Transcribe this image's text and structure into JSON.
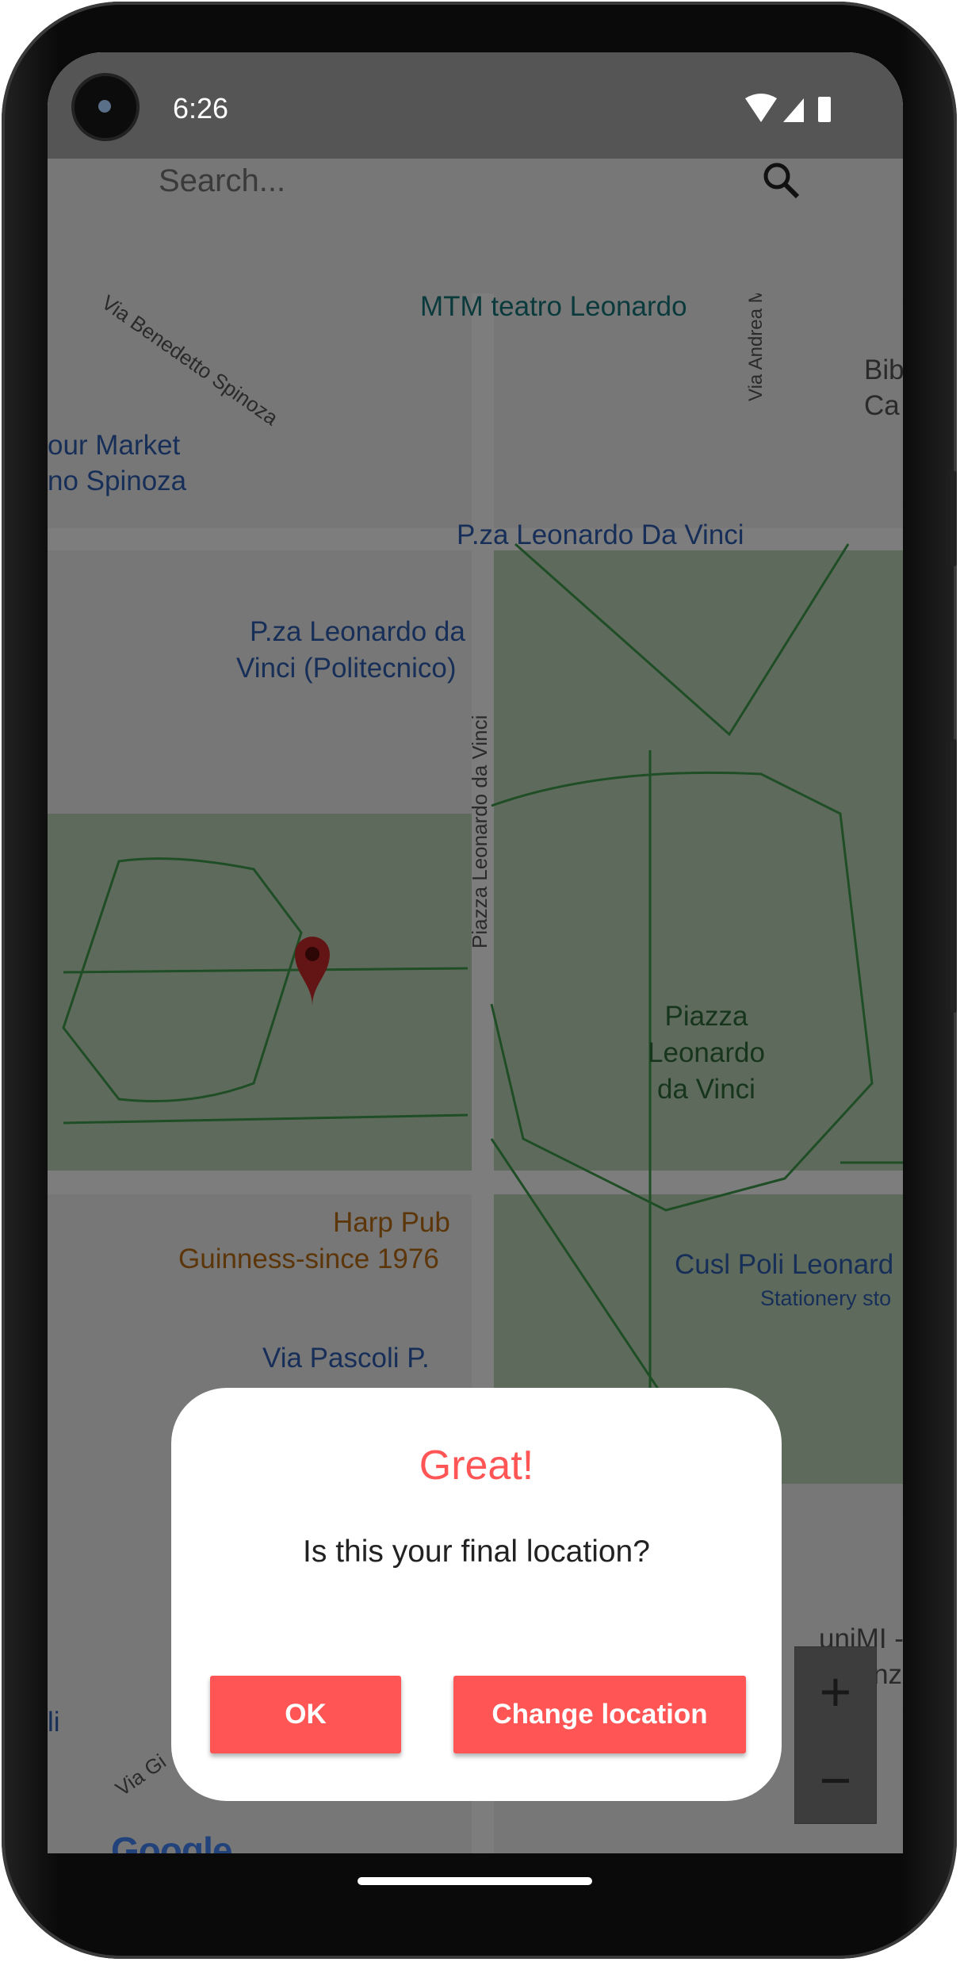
{
  "status_bar": {
    "time": "6:26",
    "icons": [
      "wifi-icon",
      "cellular-signal-icon",
      "battery-icon"
    ]
  },
  "search": {
    "placeholder": "Search...",
    "icon": "search-icon"
  },
  "map": {
    "labels": {
      "street_spinoza": "Via Benedetto Spinoza",
      "mtm": "MTM teatro Leonardo",
      "street_andrea": "Via Andrea Mar",
      "bib_1": "Bib",
      "bib_2": "Ca",
      "market_1": "our Market",
      "market_2": "no Spinoza",
      "pza_stop": "P.za Leonardo Da Vinci",
      "pza_poli_1": "P.za Leonardo da",
      "pza_poli_2": "Vinci (Politecnico)",
      "street_piazza": "Piazza Leonardo da Vinci",
      "park_1": "Piazza",
      "park_2": "Leonardo",
      "park_3": "da Vinci",
      "pub_1": "Harp Pub",
      "pub_2": "Guinness-since 1976",
      "cusl_1": "Cusl Poli Leonard",
      "cusl_2": "Stationery sto",
      "pascoli": "Via Pascoli P.",
      "unimi_1": "uniMI -",
      "unimi_2": "Scienz",
      "left_li": "li",
      "street_gi": "Via Gi"
    },
    "zoom_in": "+",
    "zoom_out": "−",
    "attribution": "Google",
    "marker_color": "#c62828"
  },
  "dialog": {
    "title": "Great!",
    "message": "Is this your final location?",
    "ok": "OK",
    "change": "Change location",
    "accent": "#ff5555"
  }
}
